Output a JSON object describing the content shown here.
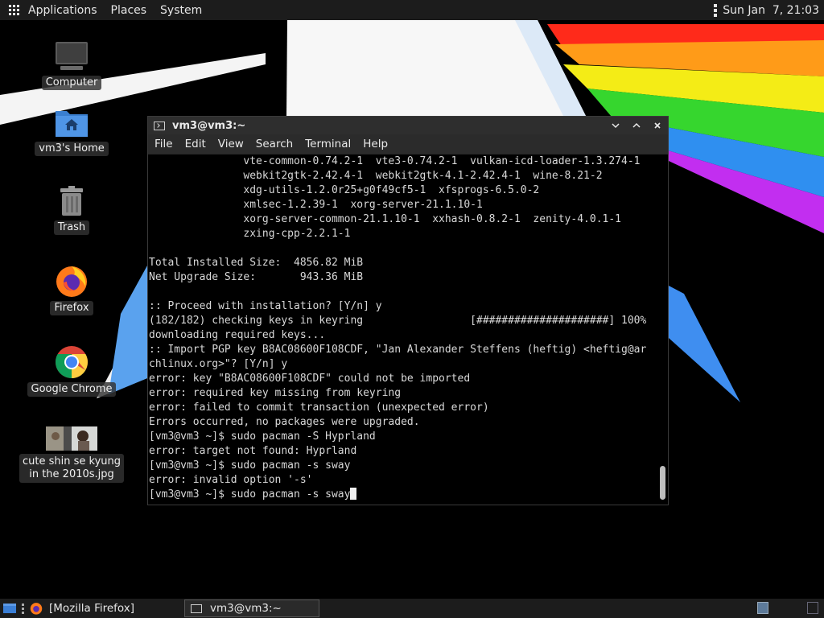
{
  "top_panel": {
    "applications": "Applications",
    "places": "Places",
    "system": "System",
    "clock": "Sun Jan  7, 21:03"
  },
  "desktop_icons": [
    {
      "label": "Computer"
    },
    {
      "label": "vm3's Home"
    },
    {
      "label": "Trash"
    },
    {
      "label": "Firefox"
    },
    {
      "label": "Google Chrome"
    },
    {
      "label": "cute shin se kyung in the 2010s.jpg"
    }
  ],
  "terminal": {
    "title": "vm3@vm3:~",
    "menu": [
      "File",
      "Edit",
      "View",
      "Search",
      "Terminal",
      "Help"
    ],
    "lines": [
      "               vte-common-0.74.2-1  vte3-0.74.2-1  vulkan-icd-loader-1.3.274-1",
      "               webkit2gtk-2.42.4-1  webkit2gtk-4.1-2.42.4-1  wine-8.21-2",
      "               xdg-utils-1.2.0r25+g0f49cf5-1  xfsprogs-6.5.0-2",
      "               xmlsec-1.2.39-1  xorg-server-21.1.10-1",
      "               xorg-server-common-21.1.10-1  xxhash-0.8.2-1  zenity-4.0.1-1",
      "               zxing-cpp-2.2.1-1",
      "",
      "Total Installed Size:  4856.82 MiB",
      "Net Upgrade Size:       943.36 MiB",
      "",
      ":: Proceed with installation? [Y/n] y",
      "(182/182) checking keys in keyring                 [#####################] 100%",
      "downloading required keys...",
      ":: Import PGP key B8AC08600F108CDF, \"Jan Alexander Steffens (heftig) <heftig@ar",
      "chlinux.org>\"? [Y/n] y",
      "error: key \"B8AC08600F108CDF\" could not be imported",
      "error: required key missing from keyring",
      "error: failed to commit transaction (unexpected error)",
      "Errors occurred, no packages were upgraded.",
      "[vm3@vm3 ~]$ sudo pacman -S Hyprland",
      "error: target not found: Hyprland",
      "[vm3@vm3 ~]$ sudo pacman -s sway",
      "error: invalid option '-s'"
    ],
    "prompt_line": "[vm3@vm3 ~]$ sudo pacman -s sway"
  },
  "bottom_panel": {
    "firefox_task": "[Mozilla Firefox]",
    "terminal_task": "vm3@vm3:~"
  }
}
